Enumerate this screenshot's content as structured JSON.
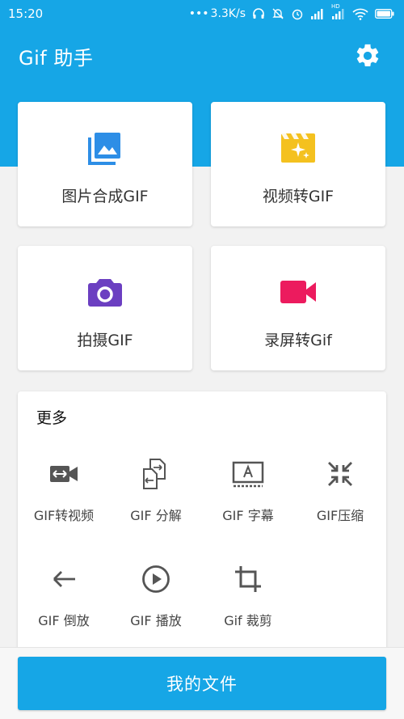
{
  "status_bar": {
    "time": "15:20",
    "net_speed": "3.3K/s",
    "hd_label": "HD"
  },
  "app_bar": {
    "title": "Gif 助手"
  },
  "cards": [
    {
      "label": "图片合成GIF",
      "icon": "image-gallery-icon",
      "color": "#2d8ee6"
    },
    {
      "label": "视频转GIF",
      "icon": "movie-sparkle-icon",
      "color": "#f4c11f"
    },
    {
      "label": "拍摄GIF",
      "icon": "camera-icon",
      "color": "#6b3fc1"
    },
    {
      "label": "录屏转Gif",
      "icon": "video-camera-icon",
      "color": "#ec1b5e"
    }
  ],
  "more": {
    "title": "更多",
    "tools": [
      {
        "label": "GIF转视频",
        "icon": "gif-to-video-icon"
      },
      {
        "label": "GIF 分解",
        "icon": "split-icon"
      },
      {
        "label": "GIF 字幕",
        "icon": "subtitle-icon"
      },
      {
        "label": "GIF压缩",
        "icon": "compress-icon"
      },
      {
        "label": "GIF 倒放",
        "icon": "arrow-back-icon"
      },
      {
        "label": "GIF 播放",
        "icon": "play-circle-icon"
      },
      {
        "label": "Gif 裁剪",
        "icon": "crop-icon"
      }
    ]
  },
  "bottom": {
    "files_label": "我的文件"
  },
  "colors": {
    "primary": "#16a6e6",
    "icon_gray": "#555555"
  }
}
